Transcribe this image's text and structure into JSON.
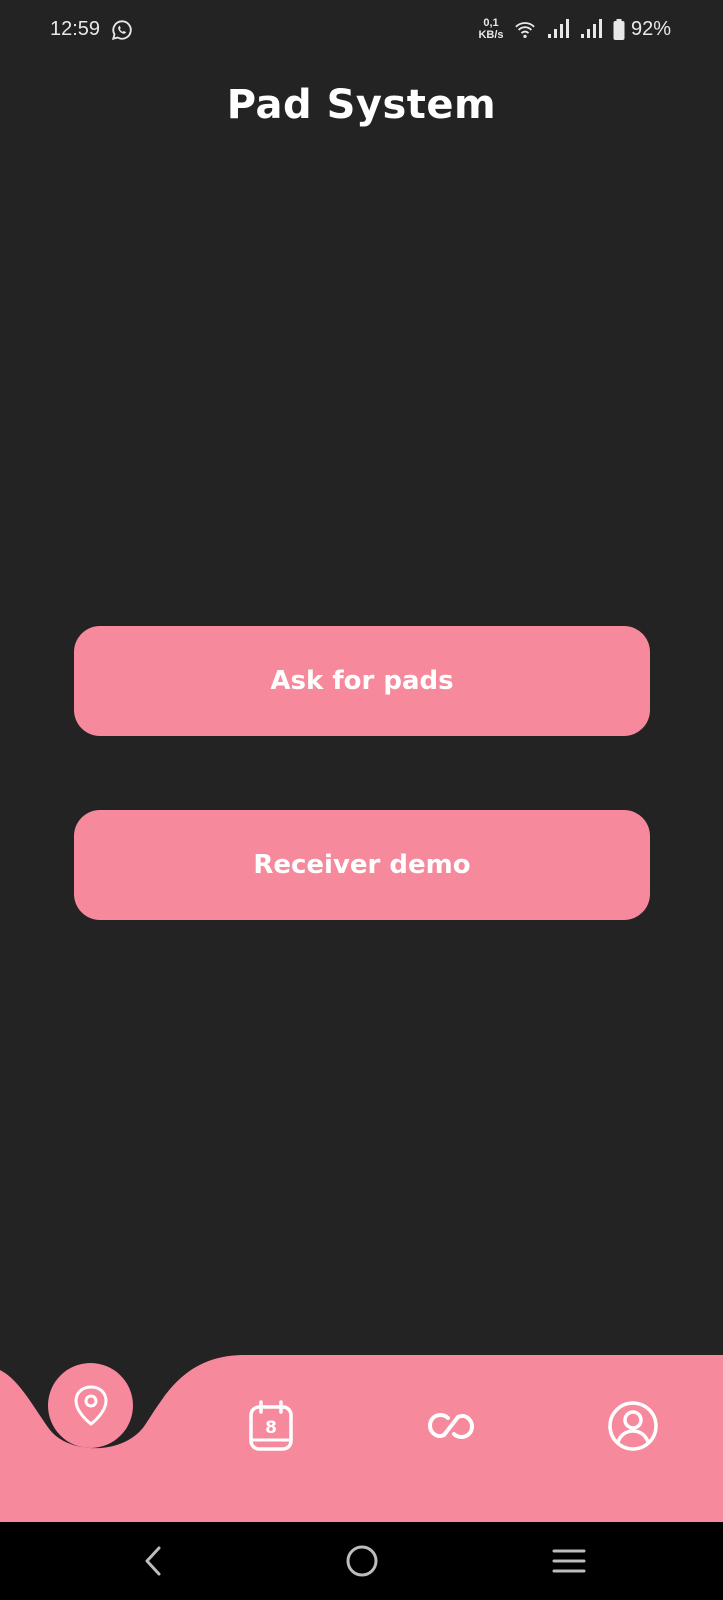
{
  "status_bar": {
    "time": "12:59",
    "net_speed_value": "0,1",
    "net_speed_unit": "KB/s",
    "battery": "92%",
    "icons": [
      "whatsapp-icon",
      "wifi-icon",
      "signal-icon",
      "signal-icon",
      "battery-icon"
    ]
  },
  "header": {
    "title": "Pad System"
  },
  "main": {
    "ask_button_label": "Ask for pads",
    "receiver_button_label": "Receiver demo"
  },
  "bottom_nav": {
    "items": [
      {
        "icon": "location-pin-icon",
        "active": true
      },
      {
        "icon": "calendar-icon",
        "badge": "8"
      },
      {
        "icon": "link-icon"
      },
      {
        "icon": "profile-icon"
      }
    ]
  },
  "system_nav": {
    "icons": [
      "back-icon",
      "home-icon",
      "recents-icon"
    ]
  },
  "colors": {
    "background": "#232323",
    "accent": "#f6899c",
    "text": "#ffffff",
    "system_bar": "#000000"
  }
}
